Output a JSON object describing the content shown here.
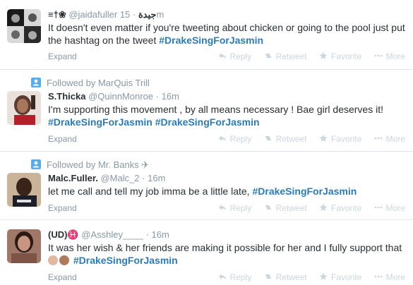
{
  "tweets": [
    {
      "context": "",
      "fullname": "≡†❀",
      "username": "@jaidafuller",
      "username_suffix": "جيدة",
      "time": "15m",
      "text_plain": "It doesn't even matter if you're tweeting about chicken or going to the pool just put the hashtag on the tweet ",
      "hashtags": [
        "#DrakeSingForJasmin"
      ]
    },
    {
      "context": "Followed by MarQuis Trill",
      "fullname": "S.Thicka",
      "username": "@QuinnMonroe",
      "time": "16m",
      "text_plain": "I'm supporting this movement , by all means necessary ! Bae girl deserves it!",
      "hashtags": [
        "#DrakeSingForJasmin",
        "#DrakeSingForJasmin"
      ]
    },
    {
      "context": "Followed by Mr. Banks ✈",
      "fullname": "Malc.Fuller.",
      "username": "@Malc_2",
      "time": "16m",
      "text_plain": "let me call and tell my job imma be a little late, ",
      "hashtags": [
        "#DrakeSingForJasmin"
      ]
    },
    {
      "context": "",
      "fullname": "(UD)♓",
      "username": "@Asshley____",
      "time": "16m",
      "text_plain": "It was her wish & her friends are making it possible for her and I fully support that ",
      "hashtags": [
        "#DrakeSingForJasmin"
      ]
    }
  ],
  "actions": {
    "expand": "Expand",
    "reply": "Reply",
    "retweet": "Retweet",
    "favorite": "Favorite",
    "more": "More"
  },
  "separator": "·",
  "colors": {
    "hashtag": "#2b7bb9",
    "muted": "#8899a6",
    "context_icon": "#55acee",
    "action_inactive": "#ccd6dd"
  }
}
